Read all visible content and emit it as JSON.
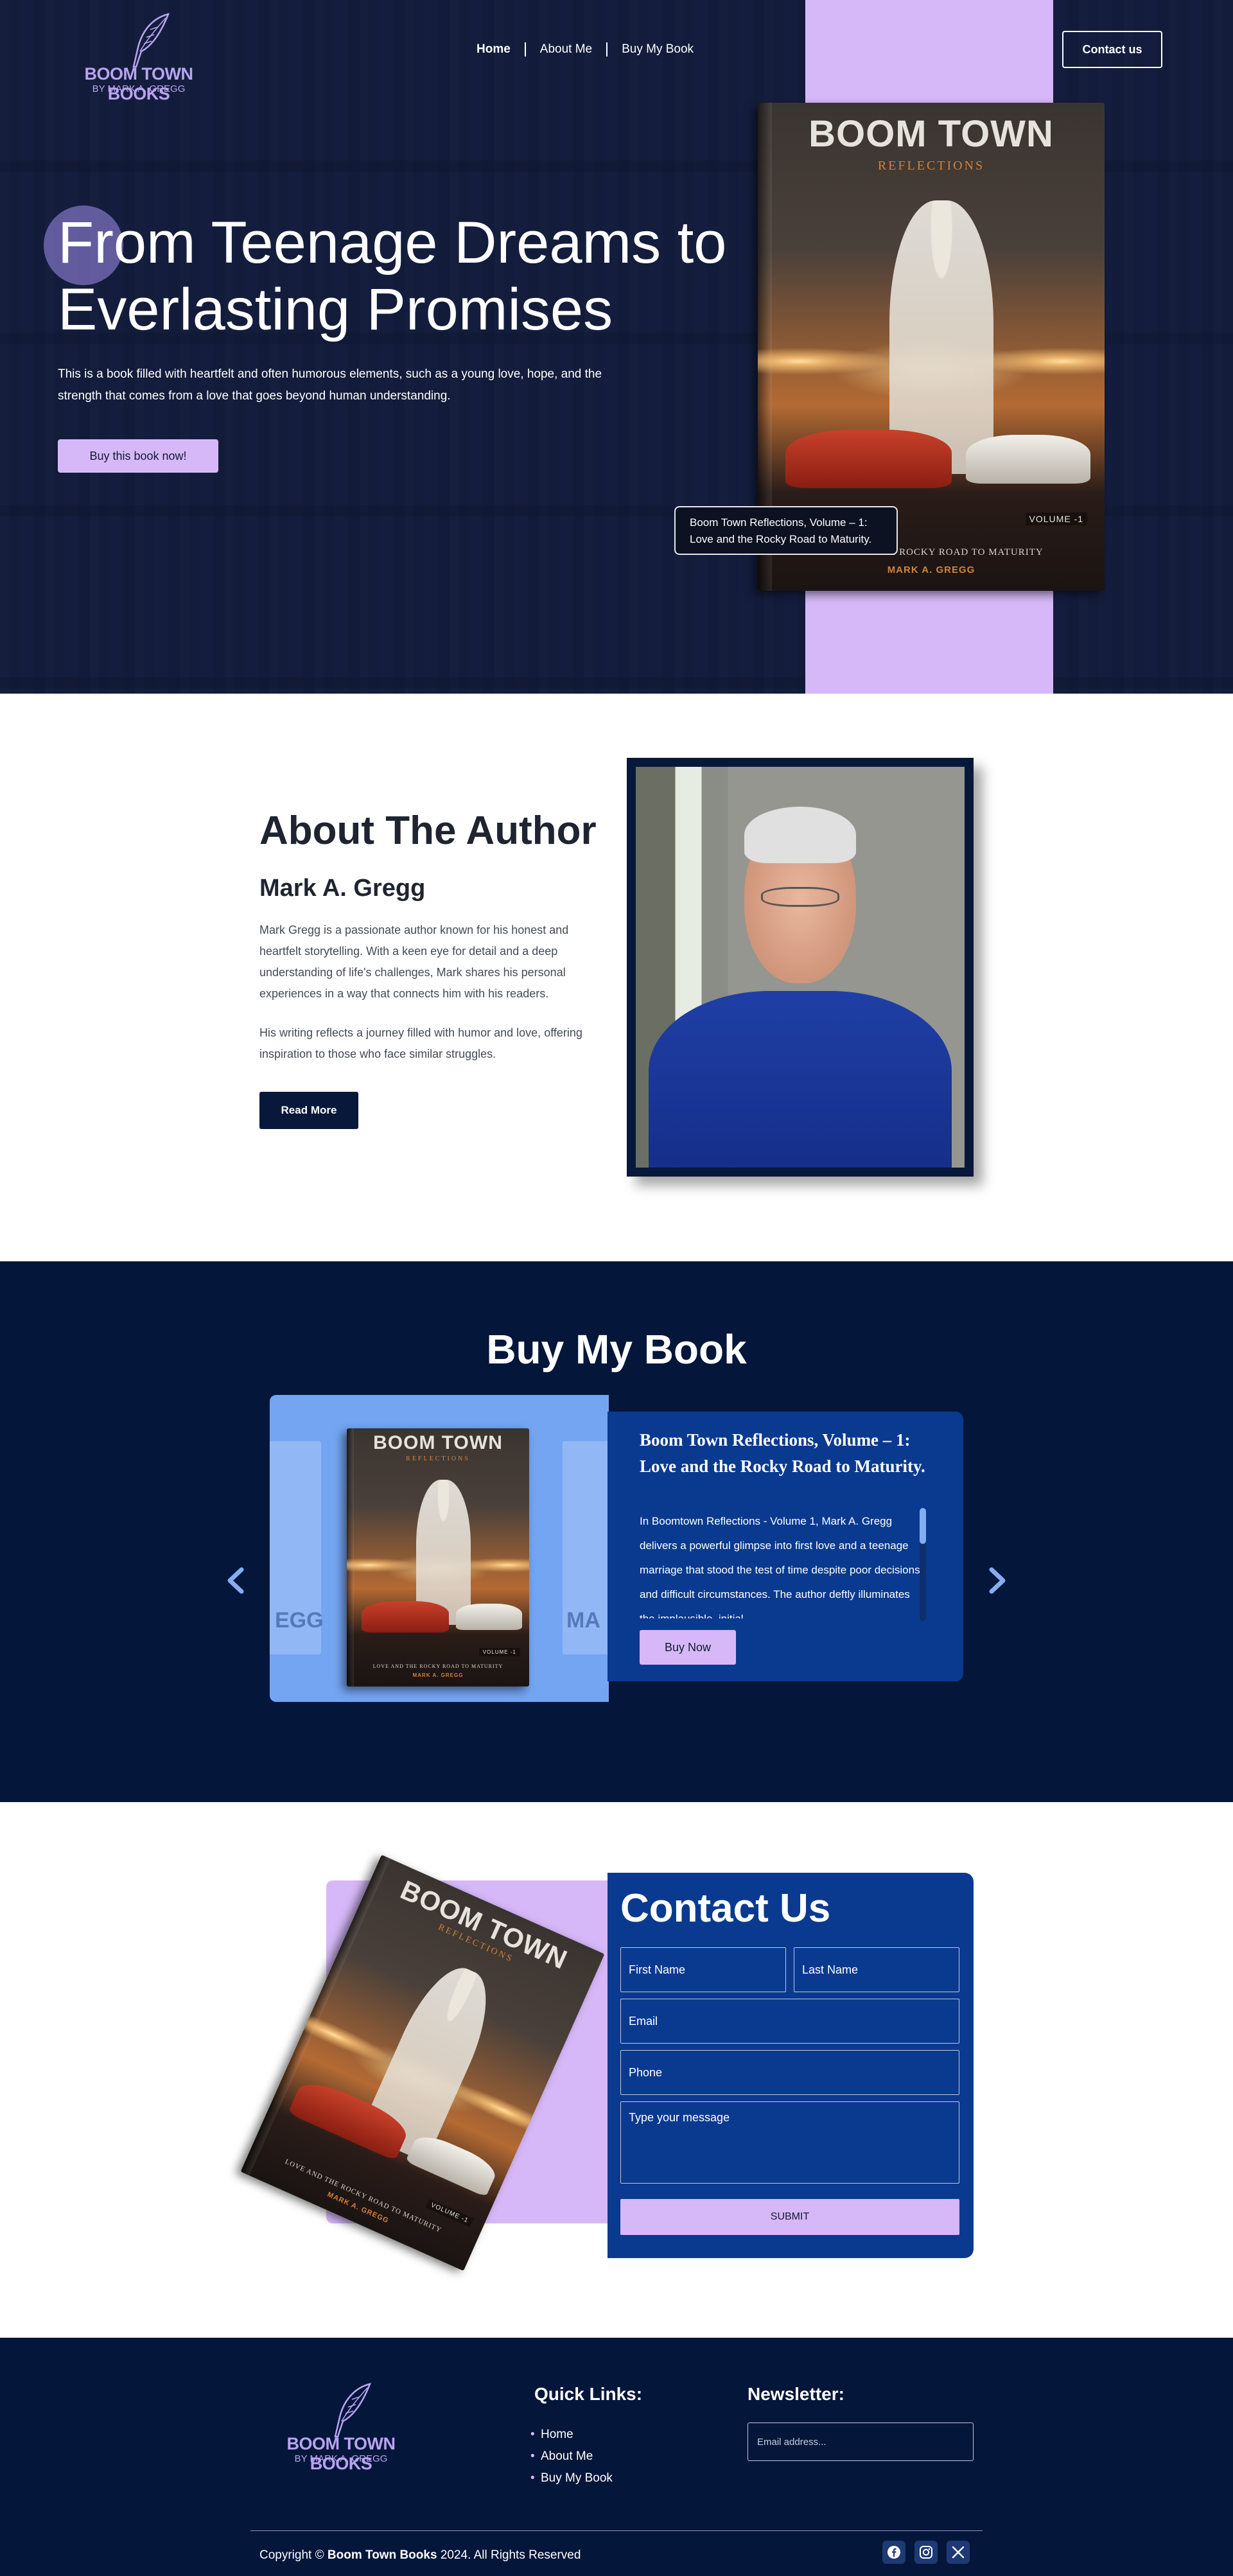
{
  "brand": {
    "logo_title": "BOOM TOWN BOOKS",
    "logo_sub": "BY MARK A. GREGG",
    "accent_color": "#d6b8f8",
    "navy_color": "#04163a",
    "blue_color": "#0a3a8f"
  },
  "nav": {
    "items": [
      {
        "label": "Home"
      },
      {
        "label": "About Me"
      },
      {
        "label": "Buy My Book"
      }
    ],
    "contact_label": "Contact us"
  },
  "hero": {
    "title": "From Teenage Dreams to Everlasting Promises",
    "description": "This is a book filled with heartfelt and often humorous elements, such as a young love, hope, and the strength that comes from a love that goes beyond human understanding.",
    "button_label": "Buy this book now!",
    "tooltip": "Boom Town Reflections, Volume – 1: Love and the Rocky Road to Maturity."
  },
  "book_cover": {
    "title": "BOOM TOWN",
    "subtitle": "REFLECTIONS",
    "volume": "VOLUME -1",
    "tagline": "LOVE AND THE ROCKY ROAD TO MATURITY",
    "author": "MARK A. GREGG"
  },
  "about": {
    "title": "About The Author",
    "name": "Mark A. Gregg",
    "paragraph1": "Mark Gregg is a passionate author known for his honest and heartfelt storytelling. With a keen eye for detail and a deep understanding of life's challenges, Mark shares his personal experiences in a way that connects him with his readers.",
    "paragraph2": "His writing reflects a journey filled with humor and love, offering inspiration to those who face similar struggles.",
    "button_label": "Read More"
  },
  "buy": {
    "title": "Buy My Book",
    "ghost_left_text": "EGG",
    "ghost_right_text": "MA",
    "slide_title": "Boom Town Reflections, Volume – 1: Love and the Rocky Road to Maturity.",
    "slide_description": "In Boomtown Reflections - Volume 1, Mark A. Gregg delivers a powerful glimpse into first love and a teenage marriage that stood the test of time despite poor decisions and difficult circumstances. The author deftly illuminates the implausible, initial",
    "button_label": "Buy Now",
    "scroll_position": 0
  },
  "contact": {
    "title": "Contact Us",
    "first_name_placeholder": "First Name",
    "last_name_placeholder": "Last Name",
    "email_placeholder": "Email",
    "phone_placeholder": "Phone",
    "message_placeholder": "Type your message",
    "submit_label": "SUBMIT"
  },
  "footer": {
    "quick_links_title": "Quick Links:",
    "quick_links": [
      "Home",
      "About Me",
      "Buy My Book"
    ],
    "newsletter_title": "Newsletter:",
    "newsletter_placeholder": "Email address...",
    "copyright_prefix": "Copyright ©",
    "copyright_brand": "Boom Town Books",
    "copyright_suffix": "2024. All Rights Reserved",
    "social_icons": [
      "facebook-icon",
      "instagram-icon",
      "x-icon"
    ]
  }
}
